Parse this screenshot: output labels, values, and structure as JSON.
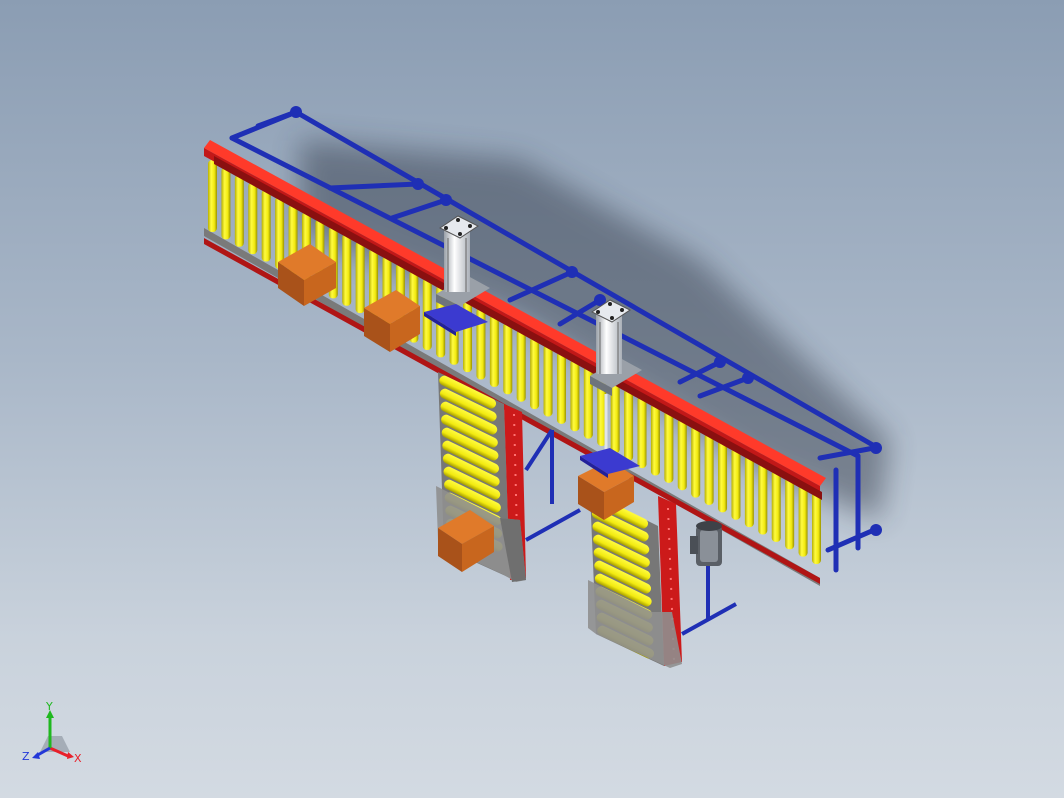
{
  "viewport": {
    "background_top": "#8b9db3",
    "background_bottom": "#d3dae2"
  },
  "colors": {
    "frame_blue": "#1f2fb5",
    "rail_red": "#d41f1f",
    "roller_yellow": "#f5f01a",
    "box_orange": "#c8661e",
    "bracket_gray": "#9a9a9a",
    "plate_blue": "#3b3ad0",
    "cylinder_silver": "#d9dde2"
  },
  "model": {
    "parts": [
      "main-conveyor",
      "branch-conveyor-left",
      "branch-conveyor-right",
      "pneumatic-pusher-left",
      "pneumatic-pusher-right",
      "drive-motor",
      "carton-1",
      "carton-2",
      "carton-3",
      "carton-4"
    ]
  },
  "triad": {
    "x_label": "X",
    "y_label": "Y",
    "z_label": "Z",
    "x_color": "#e8202a",
    "y_color": "#1fb81f",
    "z_color": "#2338d8"
  }
}
